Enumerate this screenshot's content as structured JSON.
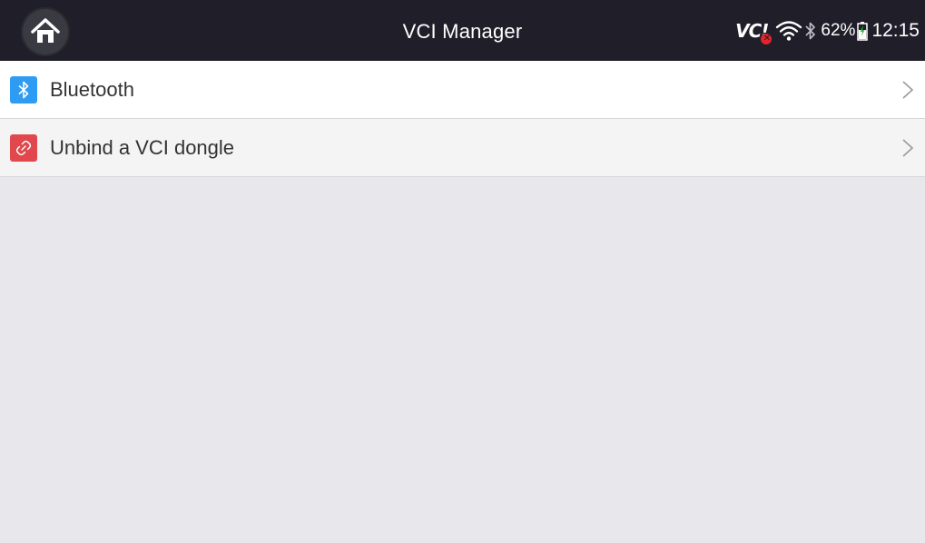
{
  "header": {
    "title": "VCI Manager",
    "home_icon": "home-icon",
    "bg_color": "#1f1e29"
  },
  "status_bar": {
    "vci_label": "VC!",
    "vci_state": "disconnected",
    "battery_percent": "62%",
    "time": "12:15",
    "icons": [
      "vci-status-icon",
      "wifi-icon",
      "bluetooth-icon",
      "battery-icon"
    ]
  },
  "menu": {
    "items": [
      {
        "label": "Bluetooth",
        "icon": "bluetooth-icon",
        "icon_color": "#2e9cf3"
      },
      {
        "label": "Unbind a VCI dongle",
        "icon": "unlink-icon",
        "icon_color": "#e0484d"
      }
    ]
  },
  "colors": {
    "background": "#e8e7eb"
  }
}
